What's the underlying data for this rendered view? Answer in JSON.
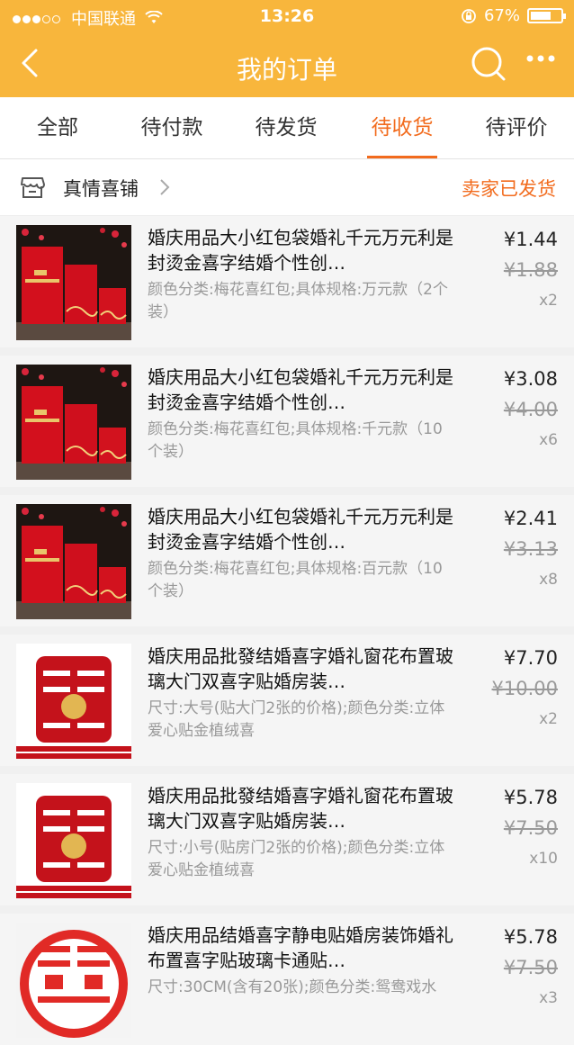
{
  "status_bar": {
    "carrier": "中国联通",
    "time": "13:26",
    "battery": "67%"
  },
  "nav": {
    "title": "我的订单"
  },
  "tabs": [
    {
      "label": "全部",
      "active": false
    },
    {
      "label": "待付款",
      "active": false
    },
    {
      "label": "待发货",
      "active": false
    },
    {
      "label": "待收货",
      "active": true
    },
    {
      "label": "待评价",
      "active": false
    }
  ],
  "colors": {
    "header": "#f8b63c",
    "accent": "#f26b1d"
  },
  "shop": {
    "name": "真情喜铺",
    "status": "卖家已发货"
  },
  "items": [
    {
      "title": "婚庆用品大小红包袋婚礼千元万元利是封烫金喜字结婚个性创…",
      "spec": "颜色分类:梅花喜红包;具体规格:万元款（2个装）",
      "price": "¥1.44",
      "original": "¥1.88",
      "qty": "x2",
      "thumb": "red-envelopes"
    },
    {
      "title": "婚庆用品大小红包袋婚礼千元万元利是封烫金喜字结婚个性创…",
      "spec": "颜色分类:梅花喜红包;具体规格:千元款（10个装）",
      "price": "¥3.08",
      "original": "¥4.00",
      "qty": "x6",
      "thumb": "red-envelopes"
    },
    {
      "title": "婚庆用品大小红包袋婚礼千元万元利是封烫金喜字结婚个性创…",
      "spec": "颜色分类:梅花喜红包;具体规格:百元款（10个装）",
      "price": "¥2.41",
      "original": "¥3.13",
      "qty": "x8",
      "thumb": "red-envelopes"
    },
    {
      "title": "婚庆用品批發结婚喜字婚礼窗花布置玻璃大门双喜字贴婚房装…",
      "spec": "尺寸:大号(贴大门2张的价格);颜色分类:立体爱心贴金植绒喜",
      "price": "¥7.70",
      "original": "¥10.00",
      "qty": "x2",
      "thumb": "double-happiness"
    },
    {
      "title": "婚庆用品批發结婚喜字婚礼窗花布置玻璃大门双喜字贴婚房装…",
      "spec": "尺寸:小号(贴房门2张的价格);颜色分类:立体爱心贴金植绒喜",
      "price": "¥5.78",
      "original": "¥7.50",
      "qty": "x10",
      "thumb": "double-happiness"
    },
    {
      "title": "婚庆用品结婚喜字静电贴婚房装饰婚礼布置喜字贴玻璃卡通贴…",
      "spec": "尺寸:30CM(含有20张);颜色分类:鸳鸯戏水",
      "price": "¥5.78",
      "original": "¥7.50",
      "qty": "x3",
      "thumb": "round-happiness"
    }
  ]
}
